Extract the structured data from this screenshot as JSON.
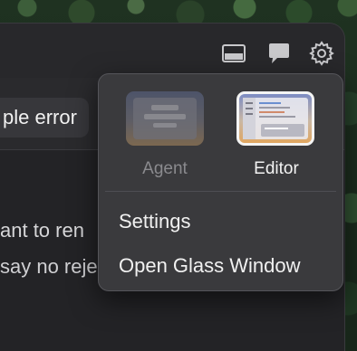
{
  "toolbar": {
    "icons": [
      "panel-icon",
      "chat-icon",
      "gear-icon"
    ]
  },
  "error_chip": {
    "text": "ple error"
  },
  "body": {
    "line1": "ant to ren",
    "line2": "say no rejects the job"
  },
  "menu": {
    "modes": [
      {
        "label": "Agent",
        "selected": false
      },
      {
        "label": "Editor",
        "selected": true
      }
    ],
    "items": [
      {
        "label": "Settings"
      },
      {
        "label": "Open Glass Window"
      }
    ]
  },
  "colors": {
    "window_bg": "#2a2a2d",
    "popover_bg": "#3a3a3d",
    "selected_border": "#f4f4f4"
  }
}
